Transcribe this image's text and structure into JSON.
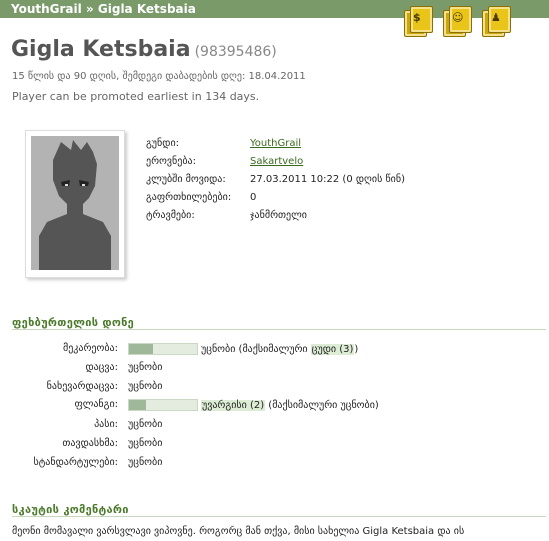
{
  "breadcrumb": {
    "part1": "YouthGrail",
    "sep": "»",
    "part2": "Gigla Ketsbaia"
  },
  "toolbar_icons": [
    "youth-player-icon",
    "print-icon",
    "player-card-icon"
  ],
  "player": {
    "name": "Gigla Ketsbaia",
    "id": "(98395486)",
    "age_line": "15 წლის და 90 დღის, შემდეგი დაბადების დღე: 18.04.2011",
    "promotion_line": "Player can be promoted earliest in 134 days."
  },
  "info": [
    {
      "label": "გუნდი:",
      "value": "YouthGrail",
      "link": true
    },
    {
      "label": "ეროვნება:",
      "value": "Sakartvelo",
      "link": true
    },
    {
      "label": "კლუბში მოვიდა:",
      "value": "27.03.2011 10:22 (0 დღის წინ)",
      "link": false
    },
    {
      "label": "გაფრთხილებები:",
      "value": "0",
      "link": false
    },
    {
      "label": "ტრავმები:",
      "value": "ჯანმრთელი",
      "link": false
    }
  ],
  "skills_title": "ფეხბურთელის დონე",
  "skills": [
    {
      "label": "მეკარეობა:",
      "bar": true,
      "bar_level": 0.35,
      "text": "უცნობი (მაქსიმალური ",
      "highlight": "ცუდი (3)",
      "text_after": ")",
      "hl_first": false
    },
    {
      "label": "დაცვა:",
      "bar": false,
      "text": "უცნობი"
    },
    {
      "label": "ნახევარდაცვა:",
      "bar": false,
      "text": "უცნობი"
    },
    {
      "label": "ფლანგი:",
      "bar": true,
      "bar_level": 0.25,
      "highlight": "უვარგისი (2)",
      "text_after": " (მაქსიმალური უცნობი)",
      "hl_first": true
    },
    {
      "label": "პასი:",
      "bar": false,
      "text": "უცნობი"
    },
    {
      "label": "თავდასხმა:",
      "bar": false,
      "text": "უცნობი"
    },
    {
      "label": "სტანდარტულები:",
      "bar": false,
      "text": "უცნობი"
    }
  ],
  "scout_title": "სკაუტის კომენტარი",
  "scout_comment": "მეონი მომავალი ვარსვლავი ვიპოვნე. როგორც მან თქვა, მისი სახელია Gigla Ketsbaia და ის"
}
